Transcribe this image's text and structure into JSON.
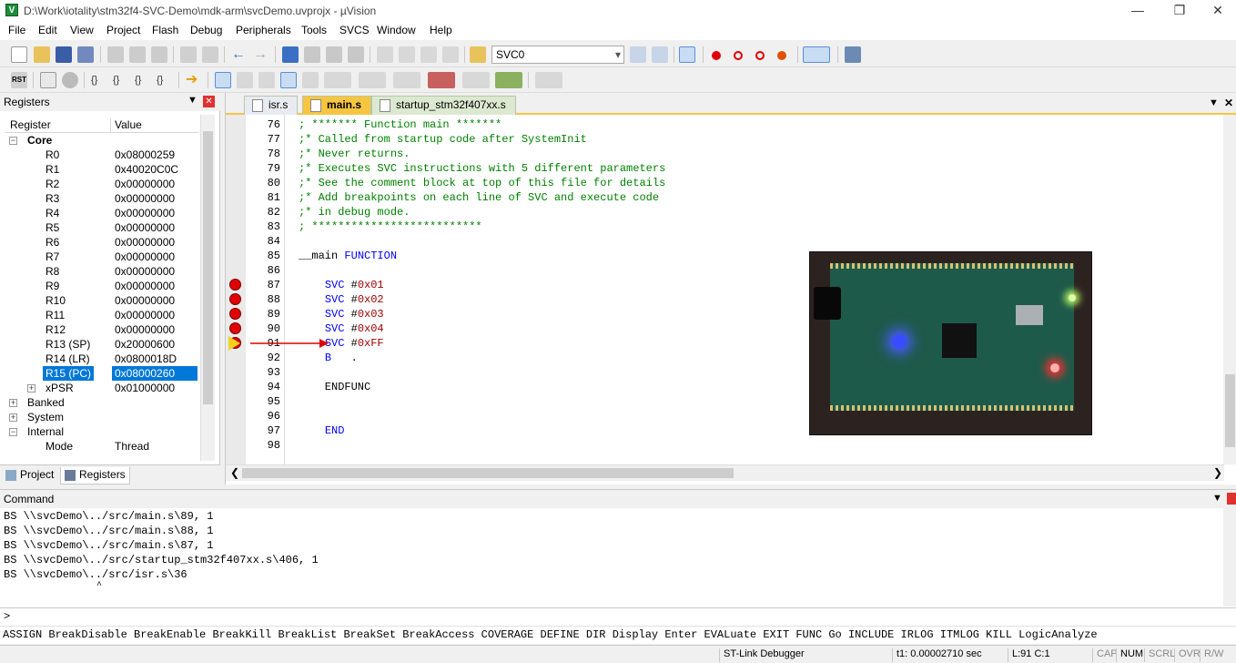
{
  "window": {
    "title": "D:\\Work\\iotality\\stm32f4-SVC-Demo\\mdk-arm\\svcDemo.uvprojx - µVision",
    "app_icon": "V"
  },
  "menu": [
    "File",
    "Edit",
    "View",
    "Project",
    "Flash",
    "Debug",
    "Peripherals",
    "Tools",
    "SVCS",
    "Window",
    "Help"
  ],
  "toolbar": {
    "target_value": "SVC0"
  },
  "registers": {
    "panel_title": "Registers",
    "col_register": "Register",
    "col_value": "Value",
    "core_label": "Core",
    "rows": [
      {
        "name": "R0",
        "value": "0x08000259"
      },
      {
        "name": "R1",
        "value": "0x40020C0C"
      },
      {
        "name": "R2",
        "value": "0x00000000"
      },
      {
        "name": "R3",
        "value": "0x00000000"
      },
      {
        "name": "R4",
        "value": "0x00000000"
      },
      {
        "name": "R5",
        "value": "0x00000000"
      },
      {
        "name": "R6",
        "value": "0x00000000"
      },
      {
        "name": "R7",
        "value": "0x00000000"
      },
      {
        "name": "R8",
        "value": "0x00000000"
      },
      {
        "name": "R9",
        "value": "0x00000000"
      },
      {
        "name": "R10",
        "value": "0x00000000"
      },
      {
        "name": "R11",
        "value": "0x00000000"
      },
      {
        "name": "R12",
        "value": "0x00000000"
      },
      {
        "name": "R13 (SP)",
        "value": "0x20000600"
      },
      {
        "name": "R14 (LR)",
        "value": "0x0800018D"
      },
      {
        "name": "R15 (PC)",
        "value": "0x08000260"
      },
      {
        "name": "xPSR",
        "value": "0x01000000"
      }
    ],
    "banked_label": "Banked",
    "system_label": "System",
    "internal_label": "Internal",
    "mode_label": "Mode",
    "mode_value": "Thread",
    "tab_project": "Project",
    "tab_registers": "Registers"
  },
  "editor": {
    "tabs": [
      "isr.s",
      "main.s",
      "startup_stm32f407xx.s"
    ],
    "lines": [
      {
        "n": "76",
        "t": "; ******* Function main *******"
      },
      {
        "n": "77",
        "t": ";* Called from startup code after SystemInit"
      },
      {
        "n": "78",
        "t": ";* Never returns."
      },
      {
        "n": "79",
        "t": ";* Executes SVC instructions with 5 different parameters"
      },
      {
        "n": "80",
        "t": ";* See the comment block at top of this file for details"
      },
      {
        "n": "81",
        "t": ";* Add breakpoints on each line of SVC and execute code"
      },
      {
        "n": "82",
        "t": ";* in debug mode."
      },
      {
        "n": "83",
        "t": "; **************************"
      },
      {
        "n": "84",
        "t": ""
      },
      {
        "n": "85",
        "t": "__main FUNCTION"
      },
      {
        "n": "86",
        "t": ""
      },
      {
        "n": "87",
        "t": "    SVC #0x01"
      },
      {
        "n": "88",
        "t": "    SVC #0x02"
      },
      {
        "n": "89",
        "t": "    SVC #0x03"
      },
      {
        "n": "90",
        "t": "    SVC #0x04"
      },
      {
        "n": "91",
        "t": "    SVC #0xFF"
      },
      {
        "n": "92",
        "t": "    B   ."
      },
      {
        "n": "93",
        "t": ""
      },
      {
        "n": "94",
        "t": "    ENDFUNC"
      },
      {
        "n": "95",
        "t": ""
      },
      {
        "n": "96",
        "t": ""
      },
      {
        "n": "97",
        "t": "    END"
      },
      {
        "n": "98",
        "t": ""
      }
    ],
    "code_parts": {
      "main_label": "__main",
      "function_kw": "FUNCTION",
      "svc_kw": "SVC",
      "b_instr": "B   .",
      "endfunc": "ENDFUNC",
      "end": "END",
      "svc_args": [
        "0x01",
        "0x02",
        "0x03",
        "0x04",
        "0xFF"
      ]
    }
  },
  "command": {
    "panel_title": "Command",
    "lines": [
      "BS \\\\svcDemo\\../src/main.s\\89, 1",
      "BS \\\\svcDemo\\../src/main.s\\88, 1",
      "BS \\\\svcDemo\\../src/main.s\\87, 1",
      "BS \\\\svcDemo\\../src/startup_stm32f407xx.s\\406, 1",
      "BS \\\\svcDemo\\../src/isr.s\\36"
    ],
    "caret_mark": "^",
    "prompt": ">",
    "keywords": "ASSIGN BreakDisable BreakEnable BreakKill BreakList BreakSet BreakAccess COVERAGE DEFINE DIR Display Enter EVALuate EXIT FUNC Go INCLUDE IRLOG ITMLOG KILL LogicAnalyze"
  },
  "status": {
    "debugger": "ST-Link Debugger",
    "time": "t1: 0.00002710 sec",
    "position": "L:91 C:1",
    "cap": "CAP",
    "num": "NUM",
    "scrl": "SCRL",
    "ovr": "OVR",
    "rw": "R/W"
  },
  "colors": {
    "accent": "#0078d7",
    "breakpoint": "#e00000",
    "comment": "#008000",
    "keyword": "#0000ff",
    "number": "#a00000",
    "tab_active": "#f6c542"
  }
}
